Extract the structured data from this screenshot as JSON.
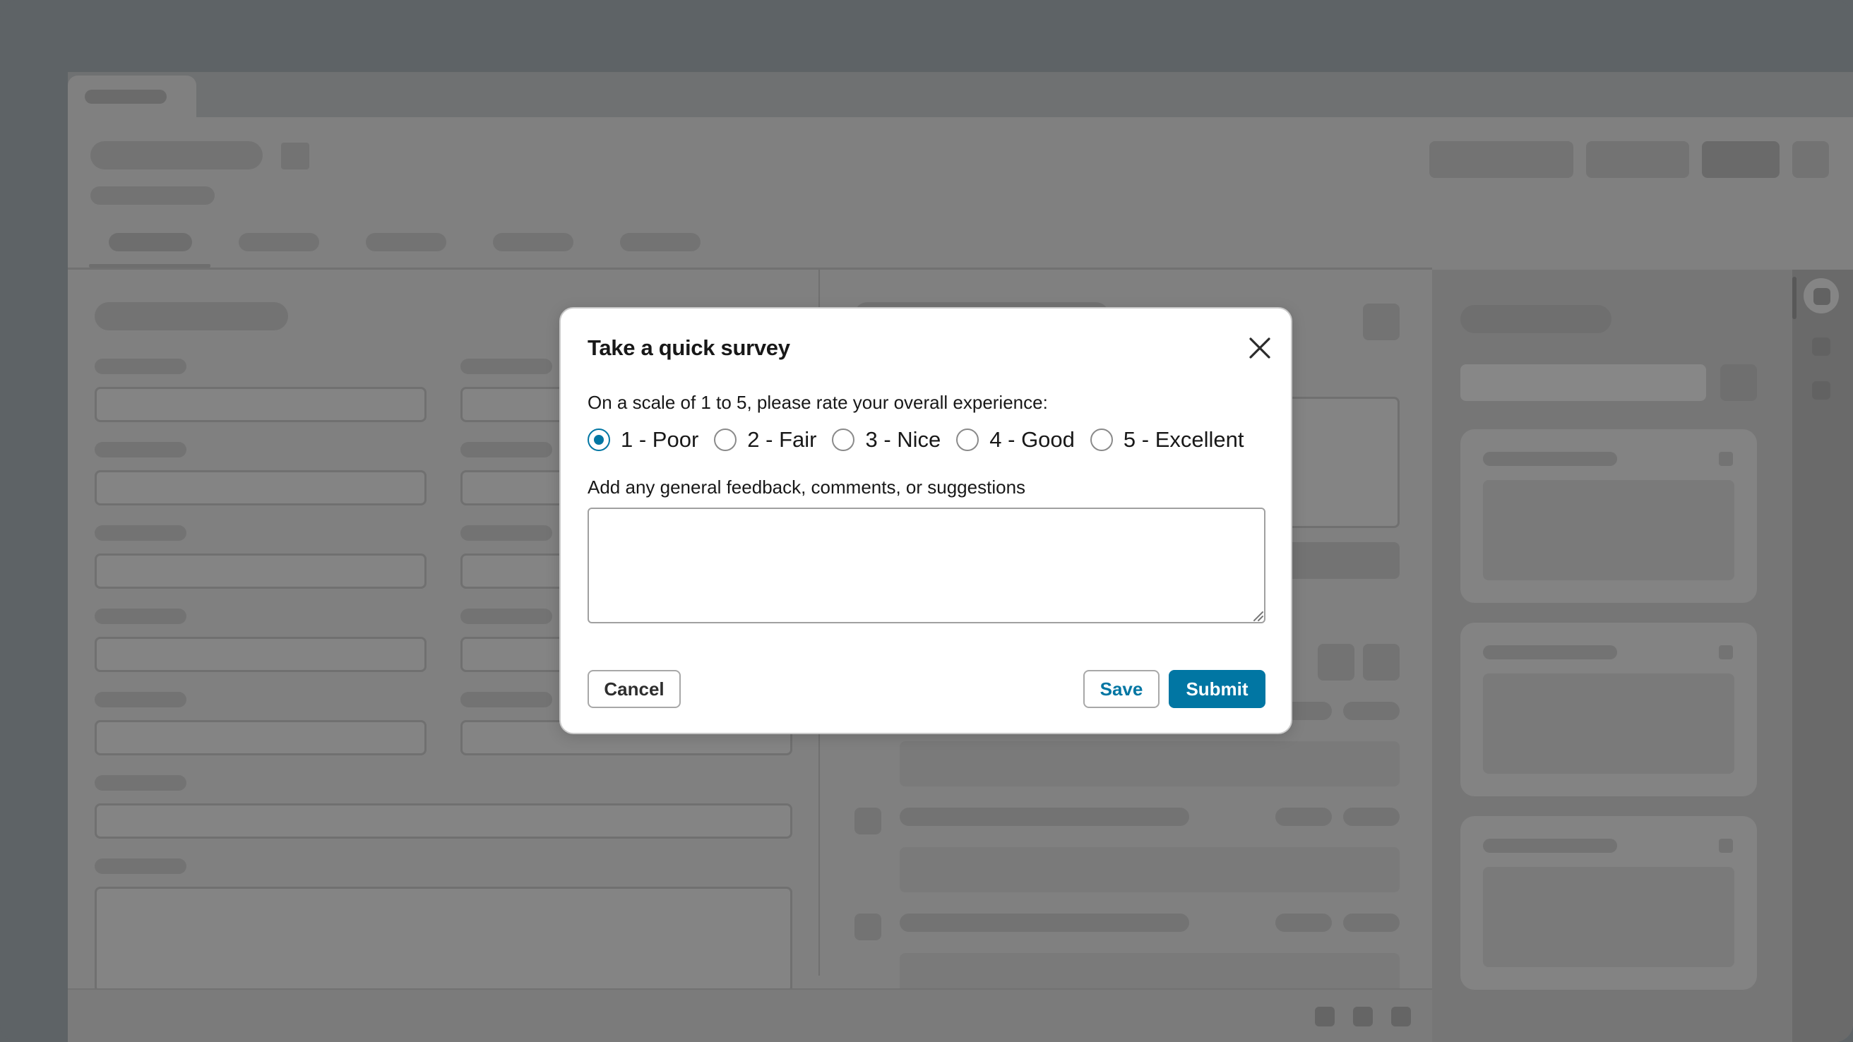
{
  "survey_modal": {
    "title": "Take a quick survey",
    "close_icon": "close-icon",
    "question": "On a scale of 1 to 5, please rate your overall experience:",
    "rating_options": [
      {
        "label": "1 - Poor",
        "selected": true
      },
      {
        "label": "2 - Fair",
        "selected": false
      },
      {
        "label": "3 - Nice",
        "selected": false
      },
      {
        "label": "4 - Good",
        "selected": false
      },
      {
        "label": "5 - Excellent",
        "selected": false
      }
    ],
    "feedback_label": "Add any general feedback, comments, or suggestions",
    "feedback_value": "",
    "cancel_label": "Cancel",
    "save_label": "Save",
    "submit_label": "Submit"
  },
  "colors": {
    "accent": "#0176a3",
    "overlay": "#5e6366",
    "modal_background": "#ffffff"
  }
}
